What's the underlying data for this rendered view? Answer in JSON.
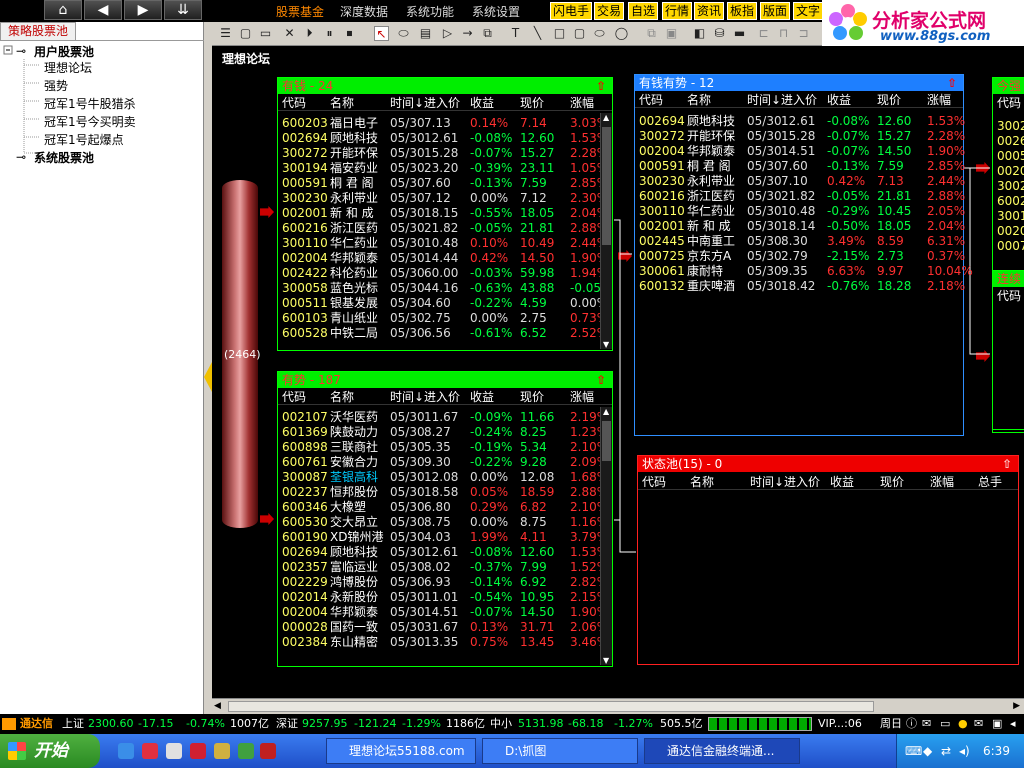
{
  "menu": {
    "home_icon": "home-icon",
    "items": [
      "股票基金",
      "深度数据",
      "系统功能",
      "系统设置"
    ],
    "buttons": [
      "闪电手",
      "交易",
      "自选",
      "行情",
      "资讯",
      "板指",
      "版面",
      "文字"
    ]
  },
  "logo": {
    "title": "分析家公式网",
    "url": "www.88gs.com"
  },
  "left_pane": {
    "tab": "策略股票池",
    "tree": [
      "用户股票池",
      "理想论坛",
      "强势",
      "冠军1号牛股猎杀",
      "冠军1号今买明卖",
      "冠军1号起爆点",
      "系统股票池"
    ]
  },
  "forum_title": "理想论坛",
  "cylinder_count": "(2464)",
  "columns": [
    "代码",
    "名称",
    "时间↓",
    "进入价",
    "收益",
    "现价",
    "涨幅",
    "总手"
  ],
  "pools": {
    "youqian": {
      "title": "有钱 - 24",
      "rows": [
        [
          "600203",
          "福日电子",
          "05/30",
          "7.13",
          "0.14%",
          "7.14",
          "3.03%"
        ],
        [
          "002694",
          "顾地科技",
          "05/30",
          "12.61",
          "-0.08%",
          "12.60",
          "1.53%"
        ],
        [
          "300272",
          "开能环保",
          "05/30",
          "15.28",
          "-0.07%",
          "15.27",
          "2.28%"
        ],
        [
          "300194",
          "福安药业",
          "05/30",
          "23.20",
          "-0.39%",
          "23.11",
          "1.05%"
        ],
        [
          "000591",
          "桐 君 阁",
          "05/30",
          "7.60",
          "-0.13%",
          "7.59",
          "2.85%"
        ],
        [
          "300230",
          "永利带业",
          "05/30",
          "7.12",
          "0.00%",
          "7.12",
          "2.30%"
        ],
        [
          "002001",
          "新 和 成",
          "05/30",
          "18.15",
          "-0.55%",
          "18.05",
          "2.04%"
        ],
        [
          "600216",
          "浙江医药",
          "05/30",
          "21.82",
          "-0.05%",
          "21.81",
          "2.88%"
        ],
        [
          "300110",
          "华仁药业",
          "05/30",
          "10.48",
          "0.10%",
          "10.49",
          "2.44%"
        ],
        [
          "002004",
          "华邦颖泰",
          "05/30",
          "14.44",
          "0.42%",
          "14.50",
          "1.90%"
        ],
        [
          "002422",
          "科伦药业",
          "05/30",
          "60.00",
          "-0.03%",
          "59.98",
          "1.94%"
        ],
        [
          "300058",
          "蓝色光标",
          "05/30",
          "44.16",
          "-0.63%",
          "43.88",
          "-0.05%"
        ],
        [
          "000511",
          "银基发展",
          "05/30",
          "4.60",
          "-0.22%",
          "4.59",
          "0.00%"
        ],
        [
          "600103",
          "青山纸业",
          "05/30",
          "2.75",
          "0.00%",
          "2.75",
          "0.73%"
        ],
        [
          "600528",
          "中铁二局",
          "05/30",
          "6.56",
          "-0.61%",
          "6.52",
          "2.52%"
        ]
      ]
    },
    "youshi": {
      "title": "有势 - 187",
      "rows": [
        [
          "002107",
          "沃华医药",
          "05/30",
          "11.67",
          "-0.09%",
          "11.66",
          "2.19%"
        ],
        [
          "601369",
          "陕鼓动力",
          "05/30",
          "8.27",
          "-0.24%",
          "8.25",
          "1.23%"
        ],
        [
          "600898",
          "三联商社",
          "05/30",
          "5.35",
          "-0.19%",
          "5.34",
          "2.10%"
        ],
        [
          "600761",
          "安徽合力",
          "05/30",
          "9.30",
          "-0.22%",
          "9.28",
          "2.09%"
        ],
        [
          "300087",
          "荃银高科",
          "05/30",
          "12.08",
          "0.00%",
          "12.08",
          "1.68%"
        ],
        [
          "002237",
          "恒邦股份",
          "05/30",
          "18.58",
          "0.05%",
          "18.59",
          "2.88%"
        ],
        [
          "600346",
          "大橡塑",
          "05/30",
          "6.80",
          "0.29%",
          "6.82",
          "2.10%"
        ],
        [
          "600530",
          "交大昂立",
          "05/30",
          "8.75",
          "0.00%",
          "8.75",
          "1.16%"
        ],
        [
          "600190",
          "XD锦州港",
          "05/30",
          "4.03",
          "1.99%",
          "4.11",
          "3.79%"
        ],
        [
          "002694",
          "顾地科技",
          "05/30",
          "12.61",
          "-0.08%",
          "12.60",
          "1.53%"
        ],
        [
          "002357",
          "富临运业",
          "05/30",
          "8.02",
          "-0.37%",
          "7.99",
          "1.52%"
        ],
        [
          "002229",
          "鸿博股份",
          "05/30",
          "6.93",
          "-0.14%",
          "6.92",
          "2.82%"
        ],
        [
          "002014",
          "永新股份",
          "05/30",
          "11.01",
          "-0.54%",
          "10.95",
          "2.15%"
        ],
        [
          "002004",
          "华邦颖泰",
          "05/30",
          "14.51",
          "-0.07%",
          "14.50",
          "1.90%"
        ],
        [
          "000028",
          "国药一致",
          "05/30",
          "31.67",
          "0.13%",
          "31.71",
          "2.06%"
        ],
        [
          "002384",
          "东山精密",
          "05/30",
          "13.35",
          "0.75%",
          "13.45",
          "3.46%"
        ]
      ]
    },
    "youqianyoushi": {
      "title": "有钱有势 - 12",
      "rows": [
        [
          "002694",
          "顾地科技",
          "05/30",
          "12.61",
          "-0.08%",
          "12.60",
          "1.53%"
        ],
        [
          "300272",
          "开能环保",
          "05/30",
          "15.28",
          "-0.07%",
          "15.27",
          "2.28%"
        ],
        [
          "002004",
          "华邦颖泰",
          "05/30",
          "14.51",
          "-0.07%",
          "14.50",
          "1.90%"
        ],
        [
          "000591",
          "桐 君 阁",
          "05/30",
          "7.60",
          "-0.13%",
          "7.59",
          "2.85%"
        ],
        [
          "300230",
          "永利带业",
          "05/30",
          "7.10",
          "0.42%",
          "7.13",
          "2.44%"
        ],
        [
          "600216",
          "浙江医药",
          "05/30",
          "21.82",
          "-0.05%",
          "21.81",
          "2.88%"
        ],
        [
          "300110",
          "华仁药业",
          "05/30",
          "10.48",
          "-0.29%",
          "10.45",
          "2.05%"
        ],
        [
          "002001",
          "新 和 成",
          "05/30",
          "18.14",
          "-0.50%",
          "18.05",
          "2.04%"
        ],
        [
          "002445",
          "中南重工",
          "05/30",
          "8.30",
          "3.49%",
          "8.59",
          "6.31%"
        ],
        [
          "000725",
          "京东方A",
          "05/30",
          "2.79",
          "-2.15%",
          "2.73",
          "0.37%"
        ],
        [
          "300061",
          "康耐特",
          "05/30",
          "9.35",
          "6.63%",
          "9.97",
          "10.04%"
        ],
        [
          "600132",
          "重庆啤酒",
          "05/30",
          "18.42",
          "-0.76%",
          "18.28",
          "2.18%"
        ]
      ]
    },
    "zhuangtai": {
      "title": "状态池(15) - 0"
    },
    "jinqiang": {
      "title": "今强",
      "rows": [
        "3002",
        "0026",
        "0005",
        "0020",
        "3002",
        "6002",
        "3001",
        "0020",
        "0007"
      ]
    },
    "lianxu": {
      "title": "连续"
    }
  },
  "status_bar": {
    "brand": "通达信",
    "sh_label": "上证",
    "sh_value": "2300.60",
    "sh_change": "-17.15",
    "sh_pct": "-0.74%",
    "sh_amount": "1007亿",
    "sz_label": "深证",
    "sz_value": "9257.95",
    "sz_change": "-121.24",
    "sz_pct": "-1.29%",
    "sz_amount": "1186亿",
    "zx_label": "中小",
    "zx_value": "5131.98",
    "zx_change": "-68.18",
    "zx_pct": "-1.27%",
    "zx_amount": "505.5亿",
    "vip": "VIP...:06",
    "weekday": "周日"
  },
  "taskbar": {
    "start": "开始",
    "tasks": [
      "理想论坛55188.com",
      "D:\\抓图",
      "通达信金融终端通..."
    ],
    "time": "6:39"
  }
}
